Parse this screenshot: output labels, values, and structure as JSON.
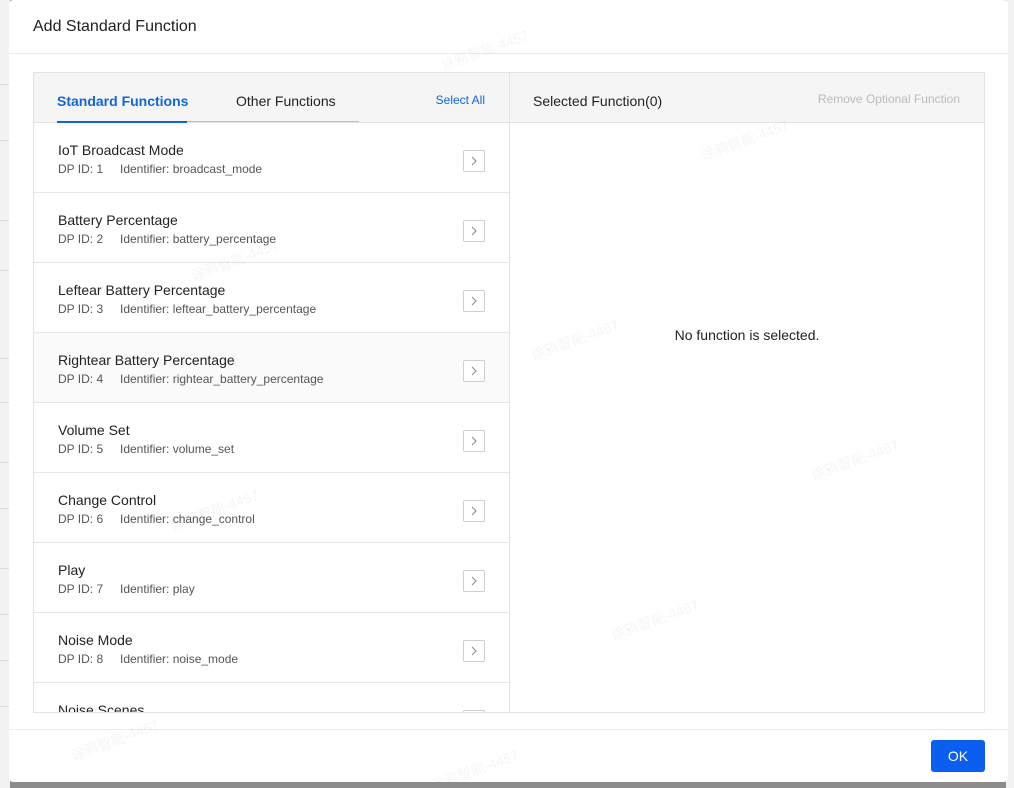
{
  "modal": {
    "title": "Add Standard Function",
    "ok_label": "OK"
  },
  "left_panel": {
    "tabs": [
      {
        "label": "Standard Functions",
        "active": true
      },
      {
        "label": "Other Functions",
        "active": false
      }
    ],
    "select_all_label": "Select All",
    "items": [
      {
        "name": "IoT Broadcast Mode",
        "dp": "DP ID: 1",
        "identifier": "Identifier: broadcast_mode"
      },
      {
        "name": "Battery Percentage",
        "dp": "DP ID: 2",
        "identifier": "Identifier: battery_percentage"
      },
      {
        "name": "Leftear Battery Percentage",
        "dp": "DP ID: 3",
        "identifier": "Identifier: leftear_battery_percentage"
      },
      {
        "name": "Rightear Battery Percentage",
        "dp": "DP ID: 4",
        "identifier": "Identifier: rightear_battery_percentage"
      },
      {
        "name": "Volume Set",
        "dp": "DP ID: 5",
        "identifier": "Identifier: volume_set"
      },
      {
        "name": "Change Control",
        "dp": "DP ID: 6",
        "identifier": "Identifier: change_control"
      },
      {
        "name": "Play",
        "dp": "DP ID: 7",
        "identifier": "Identifier: play"
      },
      {
        "name": "Noise Mode",
        "dp": "DP ID: 8",
        "identifier": "Identifier: noise_mode"
      },
      {
        "name": "Noise Scenes",
        "dp": "",
        "identifier": ""
      }
    ]
  },
  "right_panel": {
    "title": "Selected Function(0)",
    "remove_optional_label": "Remove Optional Function",
    "empty_message": "No function is selected."
  },
  "watermark_text": "涂鸦智能-4457",
  "colors": {
    "accent": "#1166dd",
    "ok_button": "#0b5ff0",
    "disabled_text": "#bbbbbb"
  }
}
